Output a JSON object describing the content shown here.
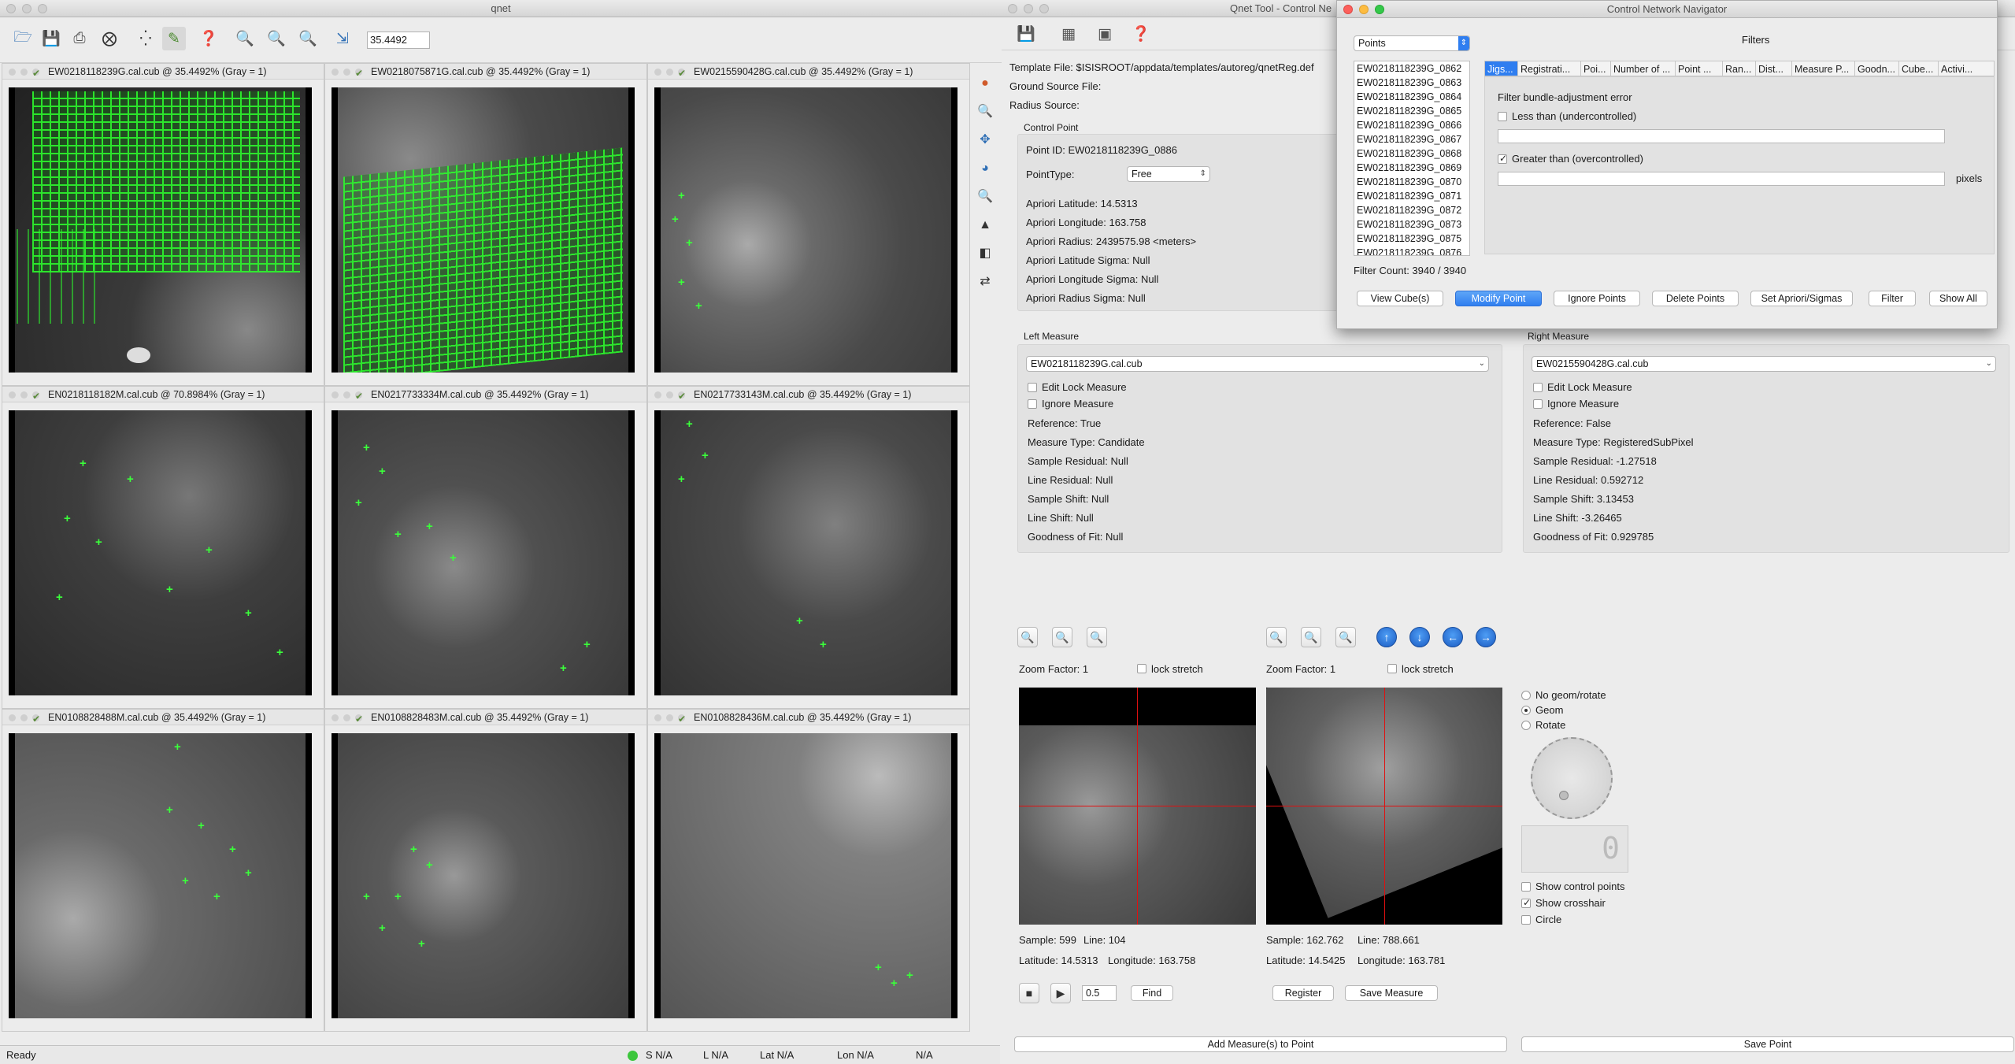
{
  "qnet": {
    "title": "qnet",
    "zoom_value": "35.4492",
    "panels": [
      {
        "title": "EW0218118239G.cal.cub @ 35.4492% (Gray = 1)"
      },
      {
        "title": "EW0218075871G.cal.cub @ 35.4492% (Gray = 1)"
      },
      {
        "title": "EW0215590428G.cal.cub @ 35.4492% (Gray = 1)"
      },
      {
        "title": "EN0218118182M.cal.cub @ 70.8984% (Gray = 1)"
      },
      {
        "title": "EN0217733334M.cal.cub @ 35.4492% (Gray = 1)"
      },
      {
        "title": "EN0217733143M.cal.cub @ 35.4492% (Gray = 1)"
      },
      {
        "title": "EN0108828488M.cal.cub @ 35.4492% (Gray = 1)"
      },
      {
        "title": "EN0108828483M.cal.cub @ 35.4492% (Gray = 1)"
      },
      {
        "title": "EN0108828436M.cal.cub @ 35.4492% (Gray = 1)"
      }
    ],
    "status": {
      "ready": "Ready",
      "s": "S N/A",
      "l": "L N/A",
      "lat": "Lat N/A",
      "lon": "Lon N/A",
      "na": "N/A"
    }
  },
  "qnet_tool": {
    "title": "Qnet Tool - Control Ne",
    "template_file": "Template File: $ISISROOT/appdata/templates/autoreg/qnetReg.def",
    "ground_source": "Ground Source File:",
    "radius_source": "Radius Source:",
    "control_point": {
      "group_title": "Control Point",
      "point_id": "Point ID:  EW0218118239G_0886",
      "point_type_label": "PointType:",
      "point_type_value": "Free",
      "apriori_lat": "Apriori Latitude:  14.5313",
      "apriori_lon": "Apriori Longitude:  163.758",
      "apriori_radius": "Apriori Radius:  2439575.98 <meters>",
      "lat_sigma": "Apriori Latitude Sigma:  Null",
      "lon_sigma": "Apriori Longitude Sigma:  Null",
      "radius_sigma": "Apriori Radius Sigma:  Null"
    },
    "left_measure": {
      "group_title": "Left Measure",
      "cube": "EW0218118239G.cal.cub",
      "edit_lock": "Edit Lock Measure",
      "ignore": "Ignore Measure",
      "reference": "Reference: True",
      "measure_type": "Measure Type: Candidate",
      "sample_residual": "Sample Residual: Null",
      "line_residual": "Line Residual: Null",
      "sample_shift": "Sample Shift: Null",
      "line_shift": "Line Shift: Null",
      "goodness": "Goodness of Fit: Null"
    },
    "right_measure": {
      "group_title": "Right Measure",
      "cube": "EW0215590428G.cal.cub",
      "edit_lock": "Edit Lock Measure",
      "ignore": "Ignore Measure",
      "reference": "Reference: False",
      "measure_type": "Measure Type: RegisteredSubPixel",
      "sample_residual": "Sample Residual: -1.27518",
      "line_residual": "Line Residual: 0.592712",
      "sample_shift": "Sample Shift: 3.13453",
      "line_shift": "Line Shift: -3.26465",
      "goodness": "Goodness of Fit: 0.929785"
    },
    "left_view": {
      "zoom_factor": "Zoom Factor: 1",
      "lock_stretch": "lock stretch",
      "sample": "Sample: 599",
      "line": "Line:  104",
      "latitude": "Latitude: 14.5313",
      "longitude": "Longitude:  163.758"
    },
    "right_view": {
      "zoom_factor": "Zoom Factor: 1",
      "lock_stretch": "lock stretch",
      "sample": "Sample: 162.762",
      "line": "Line:  788.661",
      "latitude": "Latitude: 14.5425",
      "longitude": "Longitude:  163.781"
    },
    "geom_options": {
      "none": "No geom/rotate",
      "geom": "Geom",
      "rotate": "Rotate"
    },
    "dial_readout": "0",
    "show_control_points": "Show control points",
    "show_crosshair": "Show crosshair",
    "circle": "Circle",
    "blink_interval": "0.5",
    "find": "Find",
    "register": "Register",
    "save_measure": "Save Measure",
    "add_measures": "Add Measure(s) to Point",
    "save_point": "Save Point"
  },
  "navigator": {
    "title": "Control Network Navigator",
    "mode": "Points",
    "filters_label": "Filters",
    "points": [
      "EW0218118239G_0862",
      "EW0218118239G_0863",
      "EW0218118239G_0864",
      "EW0218118239G_0865",
      "EW0218118239G_0866",
      "EW0218118239G_0867",
      "EW0218118239G_0868",
      "EW0218118239G_0869",
      "EW0218118239G_0870",
      "EW0218118239G_0871",
      "EW0218118239G_0872",
      "EW0218118239G_0873",
      "EW0218118239G_0875",
      "EW0218118239G_0876"
    ],
    "tabs": [
      "Jigs...",
      "Registrati...",
      "Poi...",
      "Number of ...",
      "Point ...",
      "Ran...",
      "Dist...",
      "Measure P...",
      "Goodn...",
      "Cube...",
      "Activi..."
    ],
    "filter_title": "Filter bundle-adjustment error",
    "less_than": "Less than (undercontrolled)",
    "greater_than": "Greater than (overcontrolled)",
    "pixels": "pixels",
    "filter_count": "Filter Count: 3940 / 3940",
    "buttons": {
      "view_cubes": "View Cube(s)",
      "modify_point": "Modify Point",
      "ignore_points": "Ignore Points",
      "delete_points": "Delete Points",
      "set_apriori": "Set Apriori/Sigmas",
      "filter": "Filter",
      "show_all": "Show All"
    }
  }
}
